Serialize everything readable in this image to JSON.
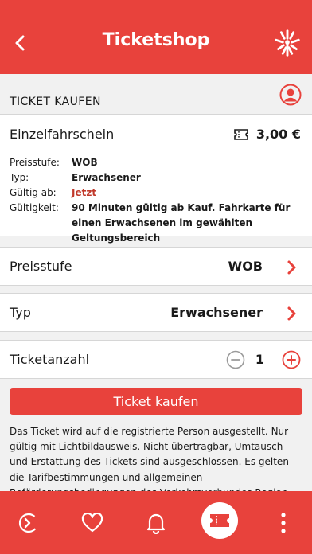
{
  "header": {
    "title": "Ticketshop"
  },
  "section": {
    "label": "TICKET KAUFEN"
  },
  "ticket": {
    "name": "Einzelfahrschein",
    "price": "3,00 €",
    "details": [
      {
        "key": "Preisstufe:",
        "value": "WOB"
      },
      {
        "key": "Typ:",
        "value": "Erwachsener"
      },
      {
        "key": "Gültig ab:",
        "value": "Jetzt"
      },
      {
        "key": "Gültigkeit:",
        "value": "90 Minuten gültig ab Kauf. Fahrkarte für einen Erwachsenen im gewählten Geltungsbereich"
      }
    ]
  },
  "options": {
    "preisstufe": {
      "label": "Preisstufe",
      "value": "WOB"
    },
    "typ": {
      "label": "Typ",
      "value": "Erwachsener"
    },
    "anzahl": {
      "label": "Ticketanzahl",
      "value": "1"
    }
  },
  "buy_button": "Ticket kaufen",
  "info_text": "Das Ticket wird auf die registrierte Person ausgestellt. Nur gültig mit Lichtbildausweis. Nicht übertragbar, Umtausch und Erstattung des Tickets sind ausgeschlossen. Es gelten die Tarifbestimmungen und allgemeinen Beförderungsbedingungen des Verkehrsverbundes Region Braunschweig (VRB) - www.vrb-online.de",
  "colors": {
    "accent": "#e8423c",
    "dark_red": "#c0392b"
  },
  "tabbar": {
    "items": [
      {
        "icon": "login-arrow-icon"
      },
      {
        "icon": "heart-icon"
      },
      {
        "icon": "bell-icon"
      },
      {
        "icon": "ticket-icon",
        "active": true
      },
      {
        "icon": "more-vertical-icon"
      }
    ]
  }
}
